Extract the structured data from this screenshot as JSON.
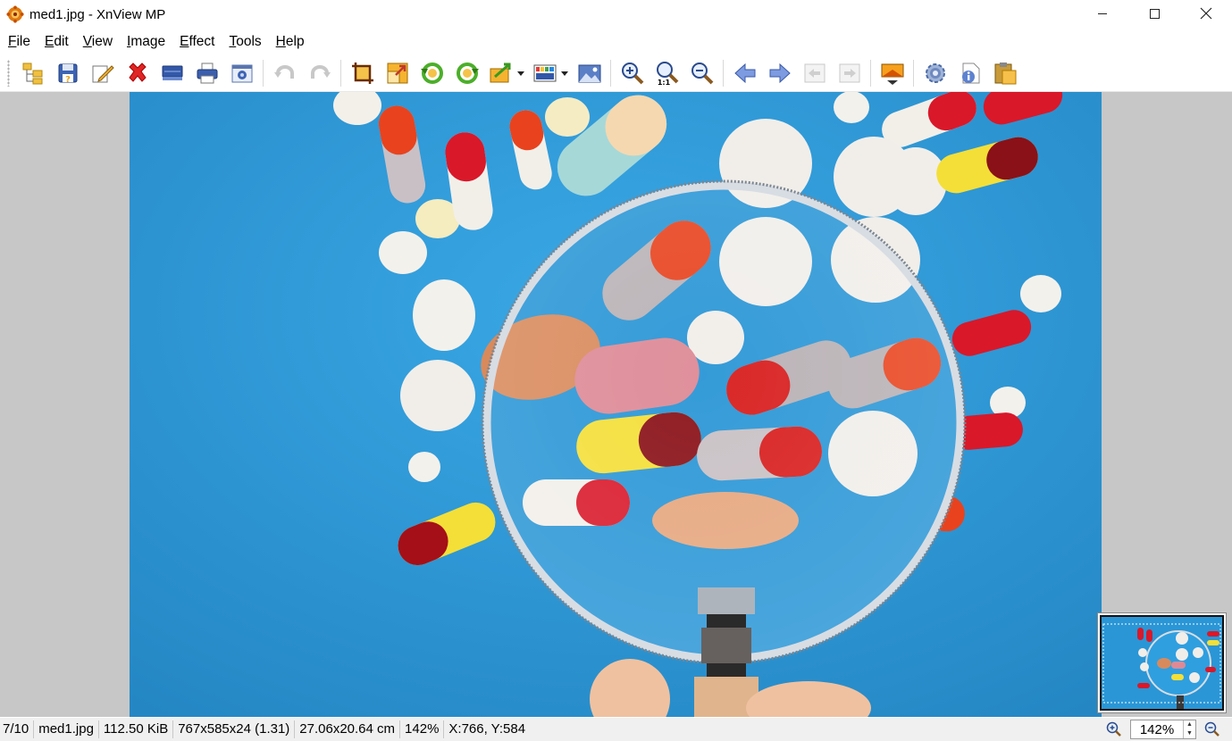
{
  "window": {
    "title": "med1.jpg - XnView MP",
    "minimize_label": "—",
    "maximize_label": "☐",
    "close_label": "✕"
  },
  "menu": [
    {
      "mnemonic": "F",
      "rest": "ile"
    },
    {
      "mnemonic": "E",
      "rest": "dit"
    },
    {
      "mnemonic": "V",
      "rest": "iew"
    },
    {
      "mnemonic": "I",
      "rest": "mage"
    },
    {
      "mnemonic": "E",
      "rest": "ffect"
    },
    {
      "mnemonic": "T",
      "rest": "ools"
    },
    {
      "mnemonic": "H",
      "rest": "elp"
    }
  ],
  "toolbar": {
    "icons": [
      "browser-icon",
      "save-icon",
      "edit-icon",
      "delete-icon",
      "scan-icon",
      "print-icon",
      "capture-icon",
      "undo-icon",
      "redo-icon",
      "crop-icon",
      "resize-icon",
      "rotate-left-icon",
      "rotate-right-icon",
      "transform-icon",
      "adjust-icon",
      "image-icon",
      "zoom-in-icon",
      "zoom-1to1-icon",
      "zoom-out-icon",
      "previous-icon",
      "next-icon",
      "first-icon",
      "last-icon",
      "slideshow-icon",
      "settings-icon",
      "info-icon",
      "clipboard-icon"
    ],
    "zoom_1to1_text": "1:1"
  },
  "colors": {
    "background_blue": "#2c9ad6",
    "viewer_gray": "#c7c7c7",
    "accent_orange": "#e8a21a"
  },
  "statusbar": {
    "position": "7/10",
    "filename": "med1.jpg",
    "filesize": "112.50 KiB",
    "dimensions": "767x585x24 (1.31)",
    "print_size": "27.06x20.64 cm",
    "zoom": "142%",
    "coordinates": "X:766, Y:584",
    "zoom_field": "142%"
  }
}
